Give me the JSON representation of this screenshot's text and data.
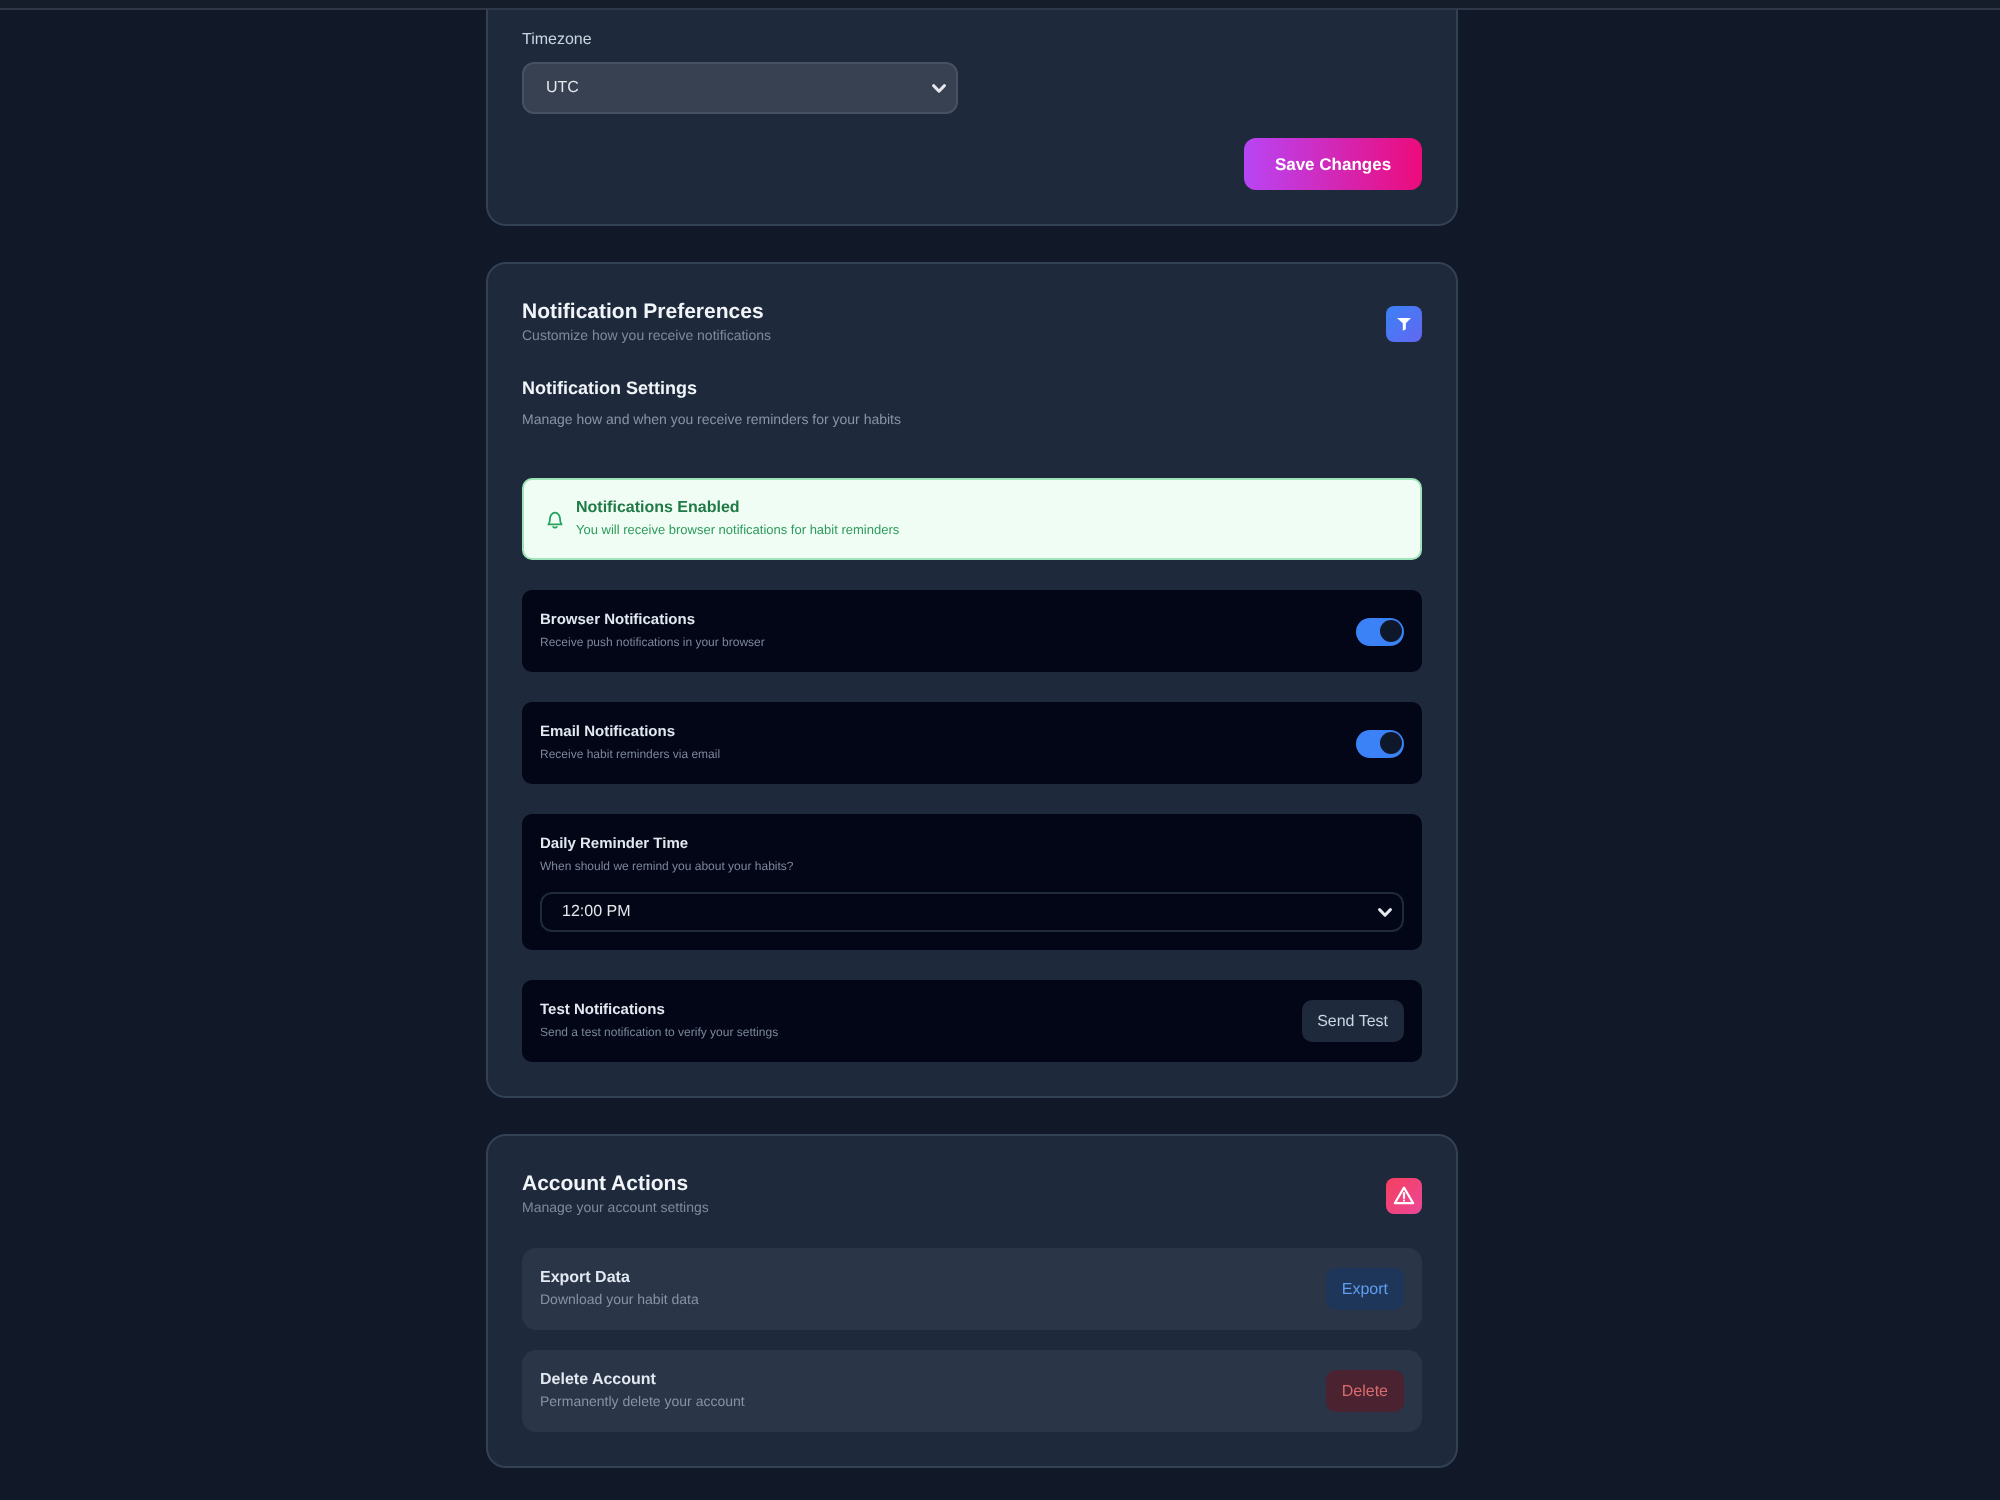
{
  "settings_card": {
    "fields": [
      {
        "label": "Timezone",
        "value": "UTC"
      }
    ],
    "save_button": "Save Changes"
  },
  "notification_card": {
    "title": "Notification Preferences",
    "subtitle": "Customize how you receive notifications",
    "section_title": "Notification Settings",
    "section_description": "Manage how and when you receive reminders for your habits",
    "alert": {
      "title": "Notifications Enabled",
      "message": "You will receive browser notifications for habit reminders"
    },
    "settings": [
      {
        "kind": "toggle",
        "title": "Browser Notifications",
        "description": "Receive push notifications in your browser",
        "on": true
      },
      {
        "kind": "toggle",
        "title": "Email Notifications",
        "description": "Receive habit reminders via email",
        "on": true
      },
      {
        "kind": "select",
        "title": "Daily Reminder Time",
        "description": "When should we remind you about your habits?",
        "value": "12:00 PM"
      },
      {
        "kind": "button",
        "title": "Test Notifications",
        "description": "Send a test notification to verify your settings",
        "button": "Send Test"
      }
    ]
  },
  "account_card": {
    "title": "Account Actions",
    "subtitle": "Manage your account settings",
    "actions": [
      {
        "kind": "export",
        "title": "Export Data",
        "description": "Download your habit data",
        "button": "Export"
      },
      {
        "kind": "delete",
        "title": "Delete Account",
        "description": "Permanently delete your account",
        "button": "Delete"
      }
    ]
  }
}
